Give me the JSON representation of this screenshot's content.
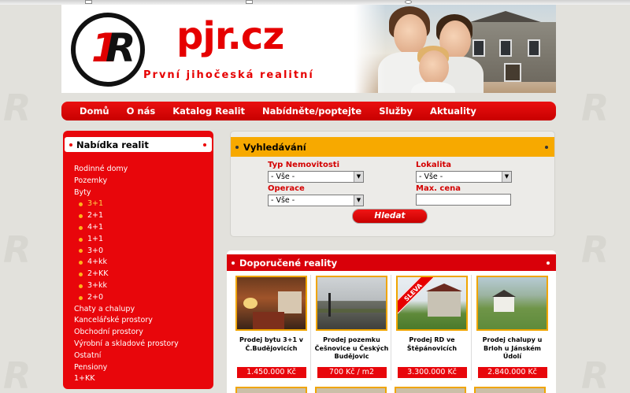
{
  "site": {
    "title": "pjr.cz",
    "tagline": "První jihočeská realitní",
    "brand_color": "#e60000"
  },
  "nav": {
    "items": [
      {
        "label": "Domů"
      },
      {
        "label": "O nás"
      },
      {
        "label": "Katalog Realit"
      },
      {
        "label": "Nabídněte/poptejte"
      },
      {
        "label": "Služby"
      },
      {
        "label": "Aktuality"
      }
    ]
  },
  "sidebar": {
    "title": "Nabídka realit",
    "items": [
      {
        "label": "Rodinné domy"
      },
      {
        "label": "Pozemky"
      },
      {
        "label": "Byty"
      },
      {
        "label": "3+1",
        "sub": true,
        "active": true
      },
      {
        "label": "2+1",
        "sub": true
      },
      {
        "label": "4+1",
        "sub": true
      },
      {
        "label": "1+1",
        "sub": true
      },
      {
        "label": "3+0",
        "sub": true
      },
      {
        "label": "4+kk",
        "sub": true
      },
      {
        "label": "2+KK",
        "sub": true
      },
      {
        "label": "3+kk",
        "sub": true
      },
      {
        "label": "2+0",
        "sub": true
      },
      {
        "label": "Chaty a chalupy"
      },
      {
        "label": "Kancelářské prostory"
      },
      {
        "label": "Obchodní prostory"
      },
      {
        "label": "Výrobní a skladové prostory"
      },
      {
        "label": "Ostatní"
      },
      {
        "label": "Pensiony"
      },
      {
        "label": "1+KK"
      }
    ]
  },
  "search": {
    "title": "Vyhledávání",
    "type_label": "Typ Nemovitosti",
    "type_value": "- Vše -",
    "location_label": "Lokalita",
    "location_value": "- Vše -",
    "operation_label": "Operace",
    "operation_value": "- Vše -",
    "max_price_label": "Max. cena",
    "max_price_value": "",
    "submit_label": "Hledat"
  },
  "recommended": {
    "title": "Doporučené reality",
    "cards": [
      {
        "title": "Prodej bytu 3+1 v Č.Budějovicích",
        "price": "1.450.000 Kč",
        "image": "apartment-interior"
      },
      {
        "title": "Prodej pozemku Češnovice u Českých Budějovic",
        "price": "700 Kč / m2",
        "image": "road-land"
      },
      {
        "title": "Prodej RD ve Štěpánovicích",
        "price": "3.300.000 Kč",
        "image": "family-house",
        "badge": "SLEVA"
      },
      {
        "title": "Prodej chalupy u Brloh u Jánském Údolí",
        "price": "2.840.000 Kč",
        "image": "cottage-hill"
      }
    ]
  }
}
